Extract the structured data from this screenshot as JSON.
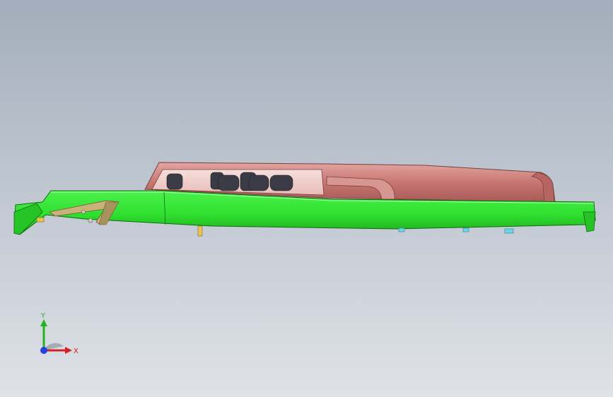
{
  "viewport": {
    "colors": {
      "background_top": "#a3adbb",
      "background_bottom": "#dfe2e7",
      "part_green": "#2fe02f",
      "part_green_dark": "#1f9a1f",
      "part_pink": "#c87773",
      "part_pink_light": "#f0d2cf",
      "part_tan": "#c8b27a",
      "part_cyan": "#6fd3e6"
    }
  },
  "triad": {
    "x_label": "X",
    "y_label": "Y",
    "x_color": "#d22222",
    "y_color": "#22b322",
    "z_color": "#2244dd",
    "icons": [
      "x-axis-arrow-icon",
      "y-axis-arrow-icon",
      "z-axis-dot-icon"
    ]
  }
}
